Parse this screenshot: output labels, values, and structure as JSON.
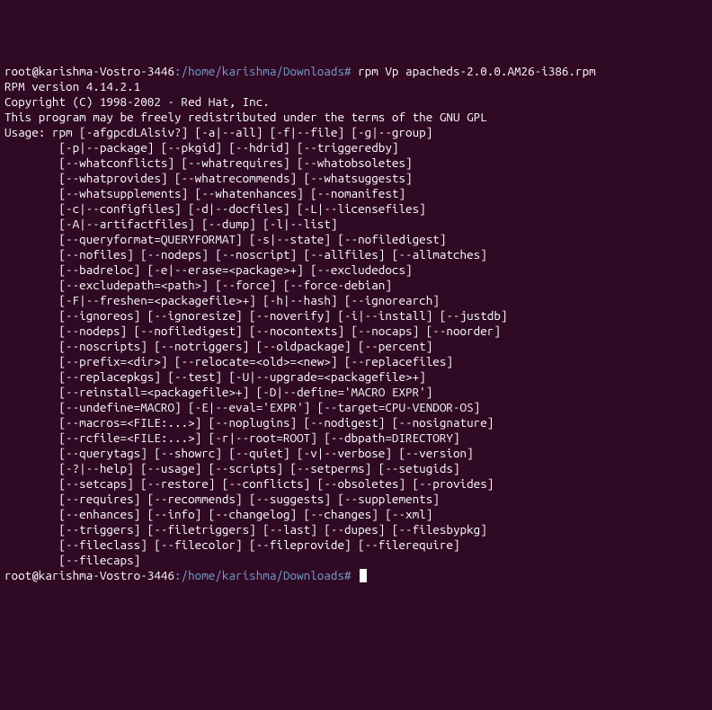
{
  "prompt1": {
    "user_host": "root@karishma-Vostro-3446",
    "path": ":/home/karishma/Downloads#",
    "command": " rpm Vp apacheds-2.0.0.AM26-i386.rpm"
  },
  "output": [
    "RPM version 4.14.2.1",
    "Copyright (C) 1998-2002 - Red Hat, Inc.",
    "This program may be freely redistributed under the terms of the GNU GPL",
    "",
    "Usage: rpm [-afgpcdLAlsiv?] [-a|--all] [-f|--file] [-g|--group]",
    "        [-p|--package] [--pkgid] [--hdrid] [--triggeredby]",
    "        [--whatconflicts] [--whatrequires] [--whatobsoletes]",
    "        [--whatprovides] [--whatrecommends] [--whatsuggests]",
    "        [--whatsupplements] [--whatenhances] [--nomanifest]",
    "        [-c|--configfiles] [-d|--docfiles] [-L|--licensefiles]",
    "        [-A|--artifactfiles] [--dump] [-l|--list]",
    "        [--queryformat=QUERYFORMAT] [-s|--state] [--nofiledigest]",
    "        [--nofiles] [--nodeps] [--noscript] [--allfiles] [--allmatches]",
    "        [--badreloc] [-e|--erase=<package>+] [--excludedocs]",
    "        [--excludepath=<path>] [--force] [--force-debian]",
    "        [-F|--freshen=<packagefile>+] [-h|--hash] [--ignorearch]",
    "        [--ignoreos] [--ignoresize] [--noverify] [-i|--install] [--justdb]",
    "        [--nodeps] [--nofiledigest] [--nocontexts] [--nocaps] [--noorder]",
    "        [--noscripts] [--notriggers] [--oldpackage] [--percent]",
    "        [--prefix=<dir>] [--relocate=<old>=<new>] [--replacefiles]",
    "        [--replacepkgs] [--test] [-U|--upgrade=<packagefile>+]",
    "        [--reinstall=<packagefile>+] [-D|--define='MACRO EXPR']",
    "        [--undefine=MACRO] [-E|--eval='EXPR'] [--target=CPU-VENDOR-OS]",
    "        [--macros=<FILE:...>] [--noplugins] [--nodigest] [--nosignature]",
    "        [--rcfile=<FILE:...>] [-r|--root=ROOT] [--dbpath=DIRECTORY]",
    "        [--querytags] [--showrc] [--quiet] [-v|--verbose] [--version]",
    "        [-?|--help] [--usage] [--scripts] [--setperms] [--setugids]",
    "        [--setcaps] [--restore] [--conflicts] [--obsoletes] [--provides]",
    "        [--requires] [--recommends] [--suggests] [--supplements]",
    "        [--enhances] [--info] [--changelog] [--changes] [--xml]",
    "        [--triggers] [--filetriggers] [--last] [--dupes] [--filesbypkg]",
    "        [--fileclass] [--filecolor] [--fileprovide] [--filerequire]",
    "        [--filecaps]"
  ],
  "prompt2": {
    "user_host": "root@karishma-Vostro-3446",
    "path": ":/home/karishma/Downloads#"
  }
}
